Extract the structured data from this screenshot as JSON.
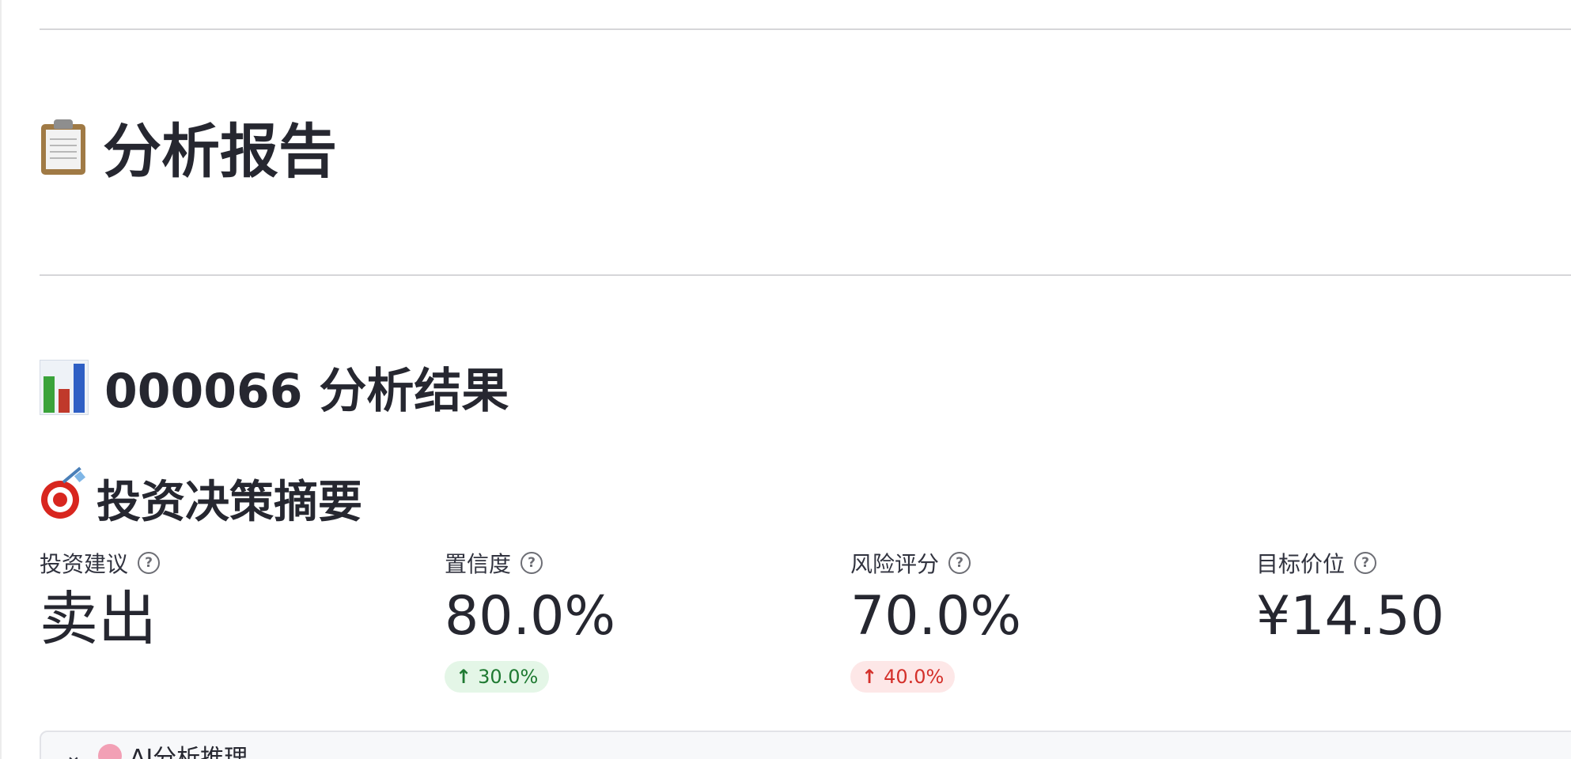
{
  "report": {
    "title": "分析报告",
    "title_icon": "clipboard-icon"
  },
  "results": {
    "title": "000066 分析结果",
    "title_icon": "bar-chart-icon"
  },
  "summary": {
    "title": "投资决策摘要",
    "title_icon": "target-icon"
  },
  "metrics": [
    {
      "label": "投资建议",
      "value": "卖出",
      "delta": null
    },
    {
      "label": "置信度",
      "value": "80.0%",
      "delta": "30.0%",
      "delta_color": "#1f7a32",
      "delta_direction": "up"
    },
    {
      "label": "风险评分",
      "value": "70.0%",
      "delta": "40.0%",
      "delta_color": "#d4302a",
      "delta_direction": "up"
    },
    {
      "label": "目标价位",
      "value": "¥14.50",
      "delta": null
    }
  ],
  "expander": {
    "label": "AI分析推理",
    "icon": "brain-icon",
    "state": "collapsed"
  },
  "colors": {
    "text": "#262730",
    "divider": "#d6d6d9",
    "delta_green_bg": "#e4f6e7",
    "delta_red_bg": "#fde7e7"
  }
}
